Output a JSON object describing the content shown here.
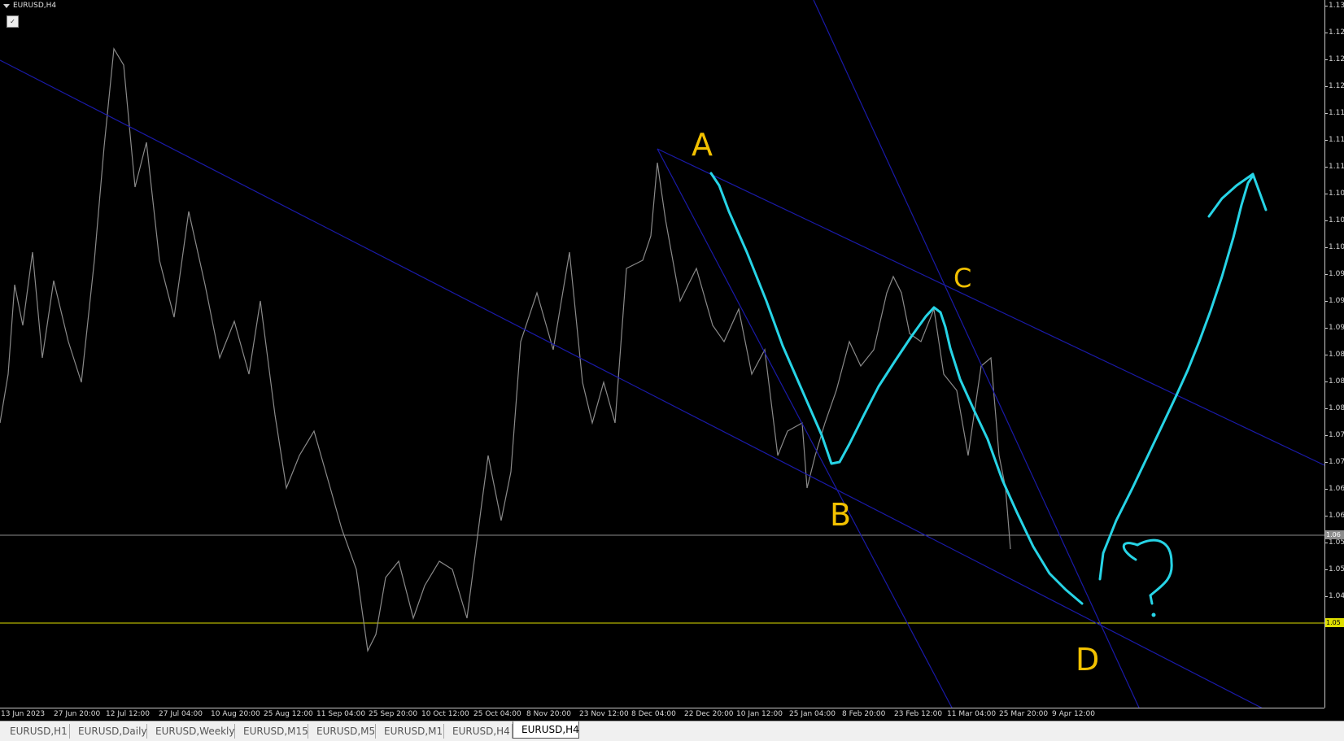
{
  "window": {
    "title": "EURUSD,H4"
  },
  "price_axis": {
    "ticks": [
      "1.13",
      "1.12",
      "1.12",
      "1.12",
      "1.11",
      "1.11",
      "1.11",
      "1.10",
      "1.10",
      "1.10",
      "1.09",
      "1.09",
      "1.09",
      "1.08",
      "1.08",
      "1.08",
      "1.07",
      "1.07",
      "1.06",
      "1.06",
      "1.05",
      "1.05",
      "1.04",
      "1.04"
    ],
    "current_price_label": "1.06",
    "horizontal_line_label": "1.05",
    "colors": {
      "current_line": "#8c8c8c",
      "horizontal_line": "#e0e000"
    }
  },
  "time_axis": {
    "ticks": [
      "13 Jun 2023",
      "27 Jun 20:00",
      "12 Jul 12:00",
      "27 Jul 04:00",
      "10 Aug 20:00",
      "25 Aug 12:00",
      "11 Sep 04:00",
      "25 Sep 20:00",
      "10 Oct 12:00",
      "25 Oct 04:00",
      "8 Nov 20:00",
      "23 Nov 12:00",
      "8 Dec 04:00",
      "22 Dec 20:00",
      "10 Jan 12:00",
      "25 Jan 04:00",
      "8 Feb 20:00",
      "23 Feb 12:00",
      "11 Mar 04:00",
      "25 Mar 20:00",
      "9 Apr 12:00"
    ]
  },
  "annotations": {
    "A": "A",
    "B": "B",
    "C": "C",
    "D": "D",
    "question": "?"
  },
  "tabs": [
    {
      "label": "EURUSD,H1",
      "active": false
    },
    {
      "label": "EURUSD,Daily",
      "active": false
    },
    {
      "label": "EURUSD,Weekly",
      "active": false
    },
    {
      "label": "EURUSD,M15",
      "active": false
    },
    {
      "label": "EURUSD,M5",
      "active": false
    },
    {
      "label": "EURUSD,M1",
      "active": false
    },
    {
      "label": "EURUSD,H4",
      "active": false
    },
    {
      "label": "EURUSD,H4",
      "active": true
    }
  ],
  "colors": {
    "background": "#000000",
    "price_series": "#8a8a8a",
    "trendlines": "#1a1aa8",
    "drawing": "#27d4e6",
    "annotation_text": "#f2c100"
  },
  "icons": {
    "title_menu": "chevron-down-icon",
    "collapse": "collapse-icon"
  }
}
